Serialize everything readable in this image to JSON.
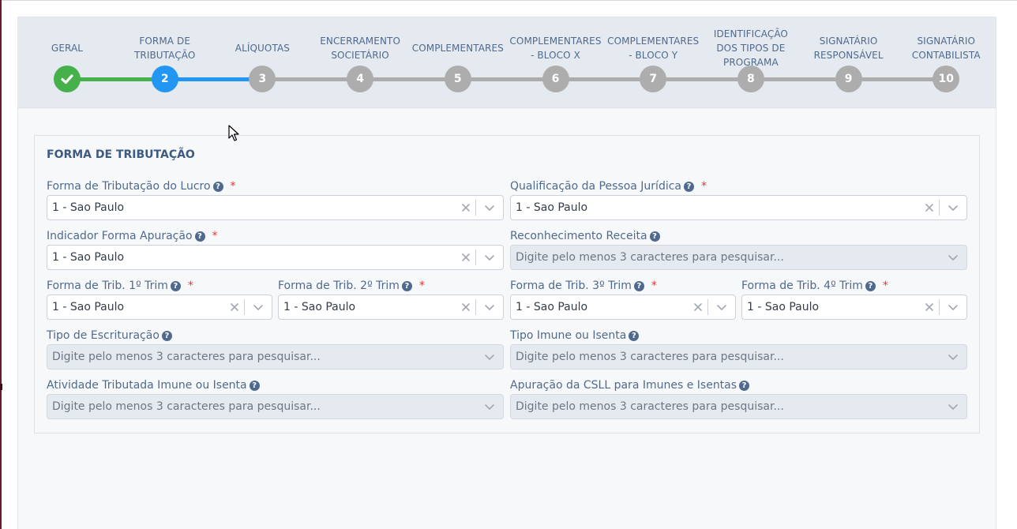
{
  "wizard": {
    "steps": [
      {
        "label": "GERAL",
        "number": "1",
        "state": "done"
      },
      {
        "label": "FORMA DE TRIBUTAÇÃO",
        "number": "2",
        "state": "active"
      },
      {
        "label": "ALÍQUOTAS",
        "number": "3",
        "state": "pending"
      },
      {
        "label": "ENCERRAMENTO SOCIETÁRIO",
        "number": "4",
        "state": "pending"
      },
      {
        "label": "COMPLEMENTARES",
        "number": "5",
        "state": "pending"
      },
      {
        "label": "COMPLEMENTARES - BLOCO X",
        "number": "6",
        "state": "pending"
      },
      {
        "label": "COMPLEMENTARES - BLOCO Y",
        "number": "7",
        "state": "pending"
      },
      {
        "label": "IDENTIFICAÇÃO DOS TIPOS DE PROGRAMA",
        "number": "8",
        "state": "pending"
      },
      {
        "label": "SIGNATÁRIO RESPONSÁVEL",
        "number": "9",
        "state": "pending"
      },
      {
        "label": "SIGNATÁRIO CONTABILISTA",
        "number": "10",
        "state": "pending"
      }
    ]
  },
  "panel": {
    "title": "FORMA DE TRIBUTAÇÃO",
    "fields": [
      {
        "label": "Forma de Tributação do Lucro",
        "required": true,
        "value": "1 - Sao Paulo",
        "placeholder": "",
        "disabled": false
      },
      {
        "label": "Qualificação da Pessoa Jurídica",
        "required": true,
        "value": "1 - Sao Paulo",
        "placeholder": "",
        "disabled": false
      },
      {
        "label": "Indicador Forma Apuração",
        "required": true,
        "value": "1 - Sao Paulo",
        "placeholder": "",
        "disabled": false
      },
      {
        "label": "Reconhecimento Receita",
        "required": false,
        "value": "",
        "placeholder": "Digite pelo menos 3 caracteres para pesquisar...",
        "disabled": true
      },
      {
        "label": "Forma de Trib. 1º Trim",
        "required": true,
        "value": "1 - Sao Paulo",
        "placeholder": "",
        "disabled": false
      },
      {
        "label": "Forma de Trib. 2º Trim",
        "required": true,
        "value": "1 - Sao Paulo",
        "placeholder": "",
        "disabled": false
      },
      {
        "label": "Forma de Trib. 3º Trim",
        "required": true,
        "value": "1 - Sao Paulo",
        "placeholder": "",
        "disabled": false
      },
      {
        "label": "Forma de Trib. 4º Trim",
        "required": true,
        "value": "1 - Sao Paulo",
        "placeholder": "",
        "disabled": false
      },
      {
        "label": "Tipo de Escrituração",
        "required": false,
        "value": "",
        "placeholder": "Digite pelo menos 3 caracteres para pesquisar...",
        "disabled": true
      },
      {
        "label": "Tipo Imune ou Isenta",
        "required": false,
        "value": "",
        "placeholder": "Digite pelo menos 3 caracteres para pesquisar...",
        "disabled": true
      },
      {
        "label": "Atividade Tributada Imune ou Isenta",
        "required": false,
        "value": "",
        "placeholder": "Digite pelo menos 3 caracteres para pesquisar...",
        "disabled": true
      },
      {
        "label": "Apuração da CSLL para Imunes e Isentas",
        "required": false,
        "value": "",
        "placeholder": "Digite pelo menos 3 caracteres para pesquisar...",
        "disabled": true
      }
    ]
  },
  "colors": {
    "done": "#46b04a",
    "active": "#2196f3",
    "pending": "#adadad"
  }
}
